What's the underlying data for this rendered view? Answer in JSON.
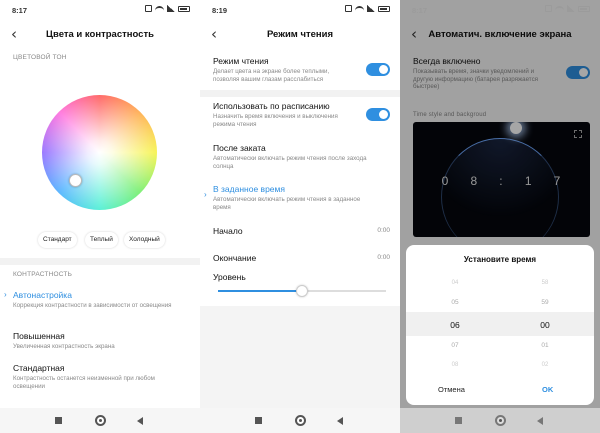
{
  "screen1": {
    "status": {
      "time": "8:17"
    },
    "title": "Цвета и контрастность",
    "tone_label": "ЦВЕТОВОЙ ТОН",
    "chips": [
      "Стандарт",
      "Теплый",
      "Холодный"
    ],
    "contrast_label": "КОНТРАСТНОСТЬ",
    "items": [
      {
        "title": "Автонастройка",
        "desc": "Коррекция контрастности в зависимости от освещения",
        "selected": true
      },
      {
        "title": "Повышенная",
        "desc": "Увеличенная контрастность экрана",
        "selected": false
      },
      {
        "title": "Стандартная",
        "desc": "Контрастность останется неизменной при любом освещении",
        "selected": false
      }
    ]
  },
  "screen2": {
    "status": {
      "time": "8:19"
    },
    "title": "Режим чтения",
    "reading": {
      "title": "Режим чтения",
      "desc": "Делает цвета на экране более теплыми, позволяя вашим глазам расслабиться",
      "enabled": true
    },
    "schedule": {
      "title": "Использовать по расписанию",
      "desc": "Назначить время включения и выключения режима чтения",
      "enabled": true
    },
    "sunset": {
      "title": "После заката",
      "desc": "Автоматически включать режим чтения после захода солнца"
    },
    "custom": {
      "title": "В заданное время",
      "desc": "Автоматически включать режим чтения в заданное время",
      "selected": true
    },
    "start": {
      "label": "Начало",
      "value": "0:00"
    },
    "end": {
      "label": "Окончание",
      "value": "0:00"
    },
    "level": {
      "label": "Уровень",
      "fraction": 0.5
    }
  },
  "screen3": {
    "status": {
      "time": "8:17"
    },
    "title": "Автоматич. включение экрана",
    "always_on": {
      "title": "Всегда включено",
      "desc": "Показывать время, значки уведомлений и другую информацию (батарея разряжается быстрее)",
      "enabled": true
    },
    "style_label": "Time style and backgroud",
    "clock_digits": [
      "0",
      "8",
      ":",
      "1",
      "7"
    ],
    "dialog": {
      "title": "Установите время",
      "hours": [
        "04",
        "05",
        "06",
        "07",
        "08"
      ],
      "minutes": [
        "58",
        "59",
        "00",
        "01",
        "02"
      ],
      "selected_hour": "06",
      "selected_minute": "00",
      "cancel": "Отмена",
      "ok": "OK"
    }
  },
  "colors": {
    "accent": "#2f8fe0",
    "divider": "#f2f2f2"
  }
}
